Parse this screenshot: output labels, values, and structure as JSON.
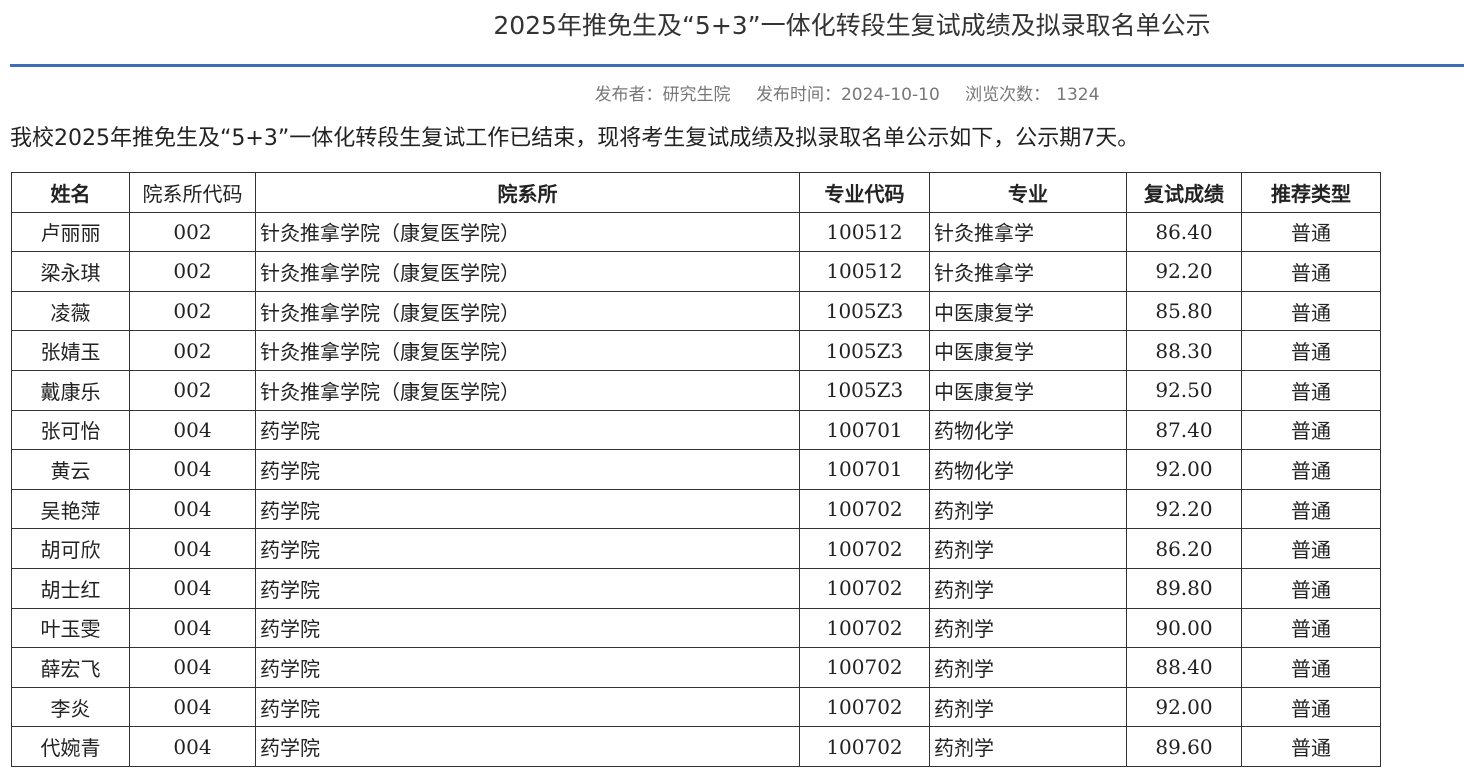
{
  "page": {
    "title": "2025年推免生及“5+3”一体化转段生复试成绩及拟录取名单公示",
    "meta": {
      "publisher_label": "发布者：",
      "publisher": "研究生院",
      "time_label": "发布时间：",
      "time": "2024-10-10",
      "views_label": "浏览次数：",
      "views": "1324"
    },
    "intro": "我校2025年推免生及“5+3”一体化转段生复试工作已结束，现将考生复试成绩及拟录取名单公示如下，公示期7天。",
    "accent_color": "#3d6db5"
  },
  "table": {
    "headers": [
      "姓名",
      "院系所代码",
      "院系所",
      "专业代码",
      "专业",
      "复试成绩",
      "推荐类型"
    ],
    "rows": [
      [
        "卢丽丽",
        "002",
        "针灸推拿学院（康复医学院）",
        "100512",
        "针灸推拿学",
        "86.40",
        "普通"
      ],
      [
        "梁永琪",
        "002",
        "针灸推拿学院（康复医学院）",
        "100512",
        "针灸推拿学",
        "92.20",
        "普通"
      ],
      [
        "凌薇",
        "002",
        "针灸推拿学院（康复医学院）",
        "1005Z3",
        "中医康复学",
        "85.80",
        "普通"
      ],
      [
        "张婧玉",
        "002",
        "针灸推拿学院（康复医学院）",
        "1005Z3",
        "中医康复学",
        "88.30",
        "普通"
      ],
      [
        "戴康乐",
        "002",
        "针灸推拿学院（康复医学院）",
        "1005Z3",
        "中医康复学",
        "92.50",
        "普通"
      ],
      [
        "张可怡",
        "004",
        "药学院",
        "100701",
        "药物化学",
        "87.40",
        "普通"
      ],
      [
        "黄云",
        "004",
        "药学院",
        "100701",
        "药物化学",
        "92.00",
        "普通"
      ],
      [
        "吴艳萍",
        "004",
        "药学院",
        "100702",
        "药剂学",
        "92.20",
        "普通"
      ],
      [
        "胡可欣",
        "004",
        "药学院",
        "100702",
        "药剂学",
        "86.20",
        "普通"
      ],
      [
        "胡士红",
        "004",
        "药学院",
        "100702",
        "药剂学",
        "89.80",
        "普通"
      ],
      [
        "叶玉雯",
        "004",
        "药学院",
        "100702",
        "药剂学",
        "90.00",
        "普通"
      ],
      [
        "薛宏飞",
        "004",
        "药学院",
        "100702",
        "药剂学",
        "88.40",
        "普通"
      ],
      [
        "李炎",
        "004",
        "药学院",
        "100702",
        "药剂学",
        "92.00",
        "普通"
      ],
      [
        "代婉青",
        "004",
        "药学院",
        "100702",
        "药剂学",
        "89.60",
        "普通"
      ]
    ]
  }
}
